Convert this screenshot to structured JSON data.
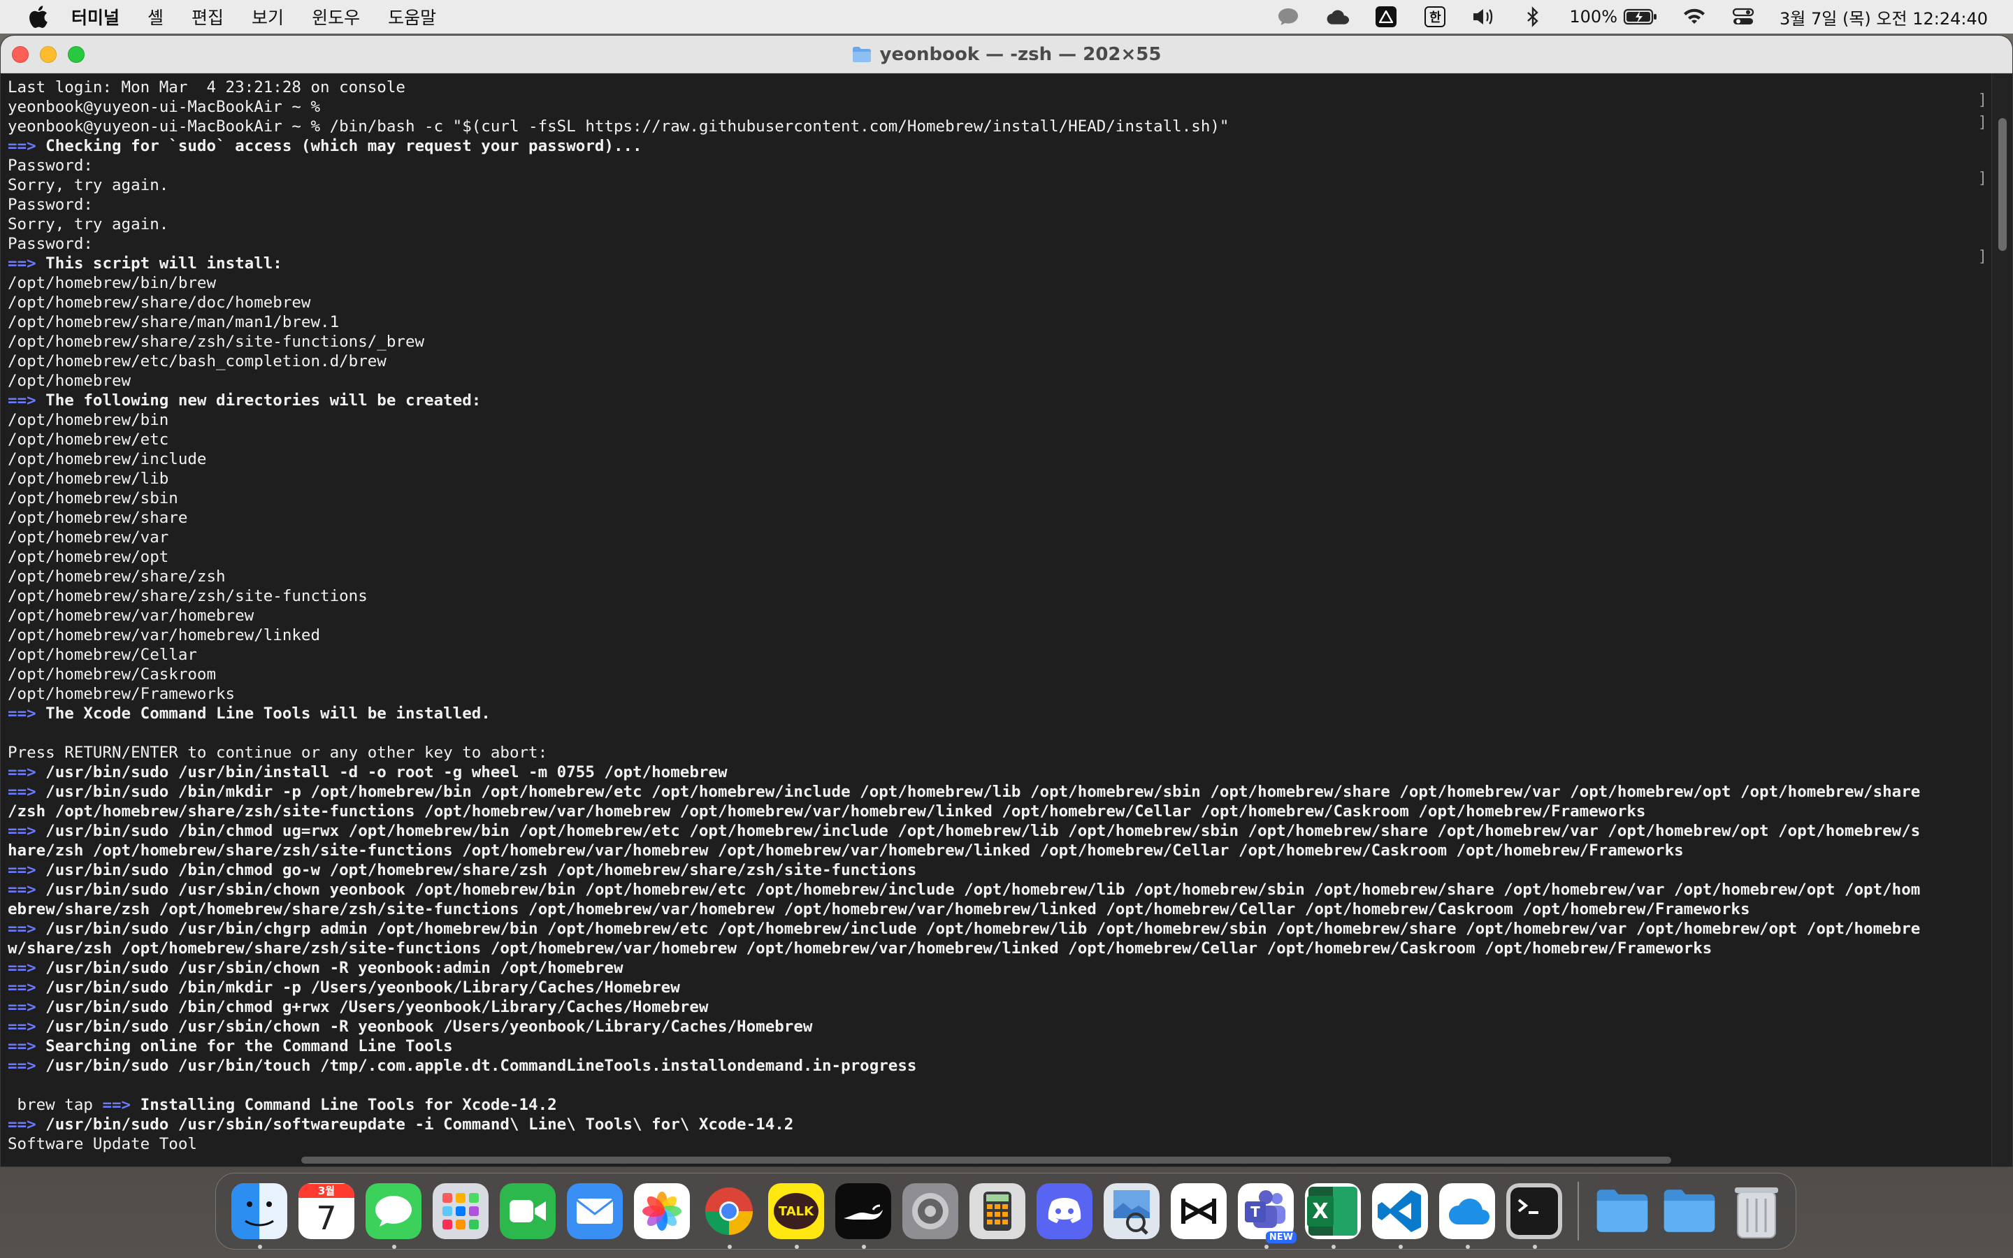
{
  "menubar": {
    "app_name": "터미널",
    "items": [
      "셸",
      "편집",
      "보기",
      "윈도우",
      "도움말"
    ],
    "battery": "100%",
    "ime": "한",
    "datetime": "3월 7일 (목) 오전 12:24:40"
  },
  "window": {
    "title": "yeonbook — -zsh — 202×55"
  },
  "terminal": {
    "lines": [
      {
        "prefix": "",
        "text": "Last login: Mon Mar  4 23:21:28 on console",
        "bold": false
      },
      {
        "prefix": "",
        "text": "yeonbook@yuyeon-ui-MacBookAir ~ %",
        "bold": false
      },
      {
        "prefix": "",
        "text": "yeonbook@yuyeon-ui-MacBookAir ~ % /bin/bash -c \"$(curl -fsSL https://raw.githubusercontent.com/Homebrew/install/HEAD/install.sh)\"",
        "bold": false
      },
      {
        "prefix": "==>",
        "text": " Checking for `sudo` access (which may request your password)...",
        "bold": true
      },
      {
        "prefix": "",
        "text": "Password:",
        "bold": false
      },
      {
        "prefix": "",
        "text": "Sorry, try again.",
        "bold": false
      },
      {
        "prefix": "",
        "text": "Password:",
        "bold": false
      },
      {
        "prefix": "",
        "text": "Sorry, try again.",
        "bold": false
      },
      {
        "prefix": "",
        "text": "Password:",
        "bold": false
      },
      {
        "prefix": "==>",
        "text": " This script will install:",
        "bold": true
      },
      {
        "prefix": "",
        "text": "/opt/homebrew/bin/brew",
        "bold": false
      },
      {
        "prefix": "",
        "text": "/opt/homebrew/share/doc/homebrew",
        "bold": false
      },
      {
        "prefix": "",
        "text": "/opt/homebrew/share/man/man1/brew.1",
        "bold": false
      },
      {
        "prefix": "",
        "text": "/opt/homebrew/share/zsh/site-functions/_brew",
        "bold": false
      },
      {
        "prefix": "",
        "text": "/opt/homebrew/etc/bash_completion.d/brew",
        "bold": false
      },
      {
        "prefix": "",
        "text": "/opt/homebrew",
        "bold": false
      },
      {
        "prefix": "==>",
        "text": " The following new directories will be created:",
        "bold": true
      },
      {
        "prefix": "",
        "text": "/opt/homebrew/bin",
        "bold": false
      },
      {
        "prefix": "",
        "text": "/opt/homebrew/etc",
        "bold": false
      },
      {
        "prefix": "",
        "text": "/opt/homebrew/include",
        "bold": false
      },
      {
        "prefix": "",
        "text": "/opt/homebrew/lib",
        "bold": false
      },
      {
        "prefix": "",
        "text": "/opt/homebrew/sbin",
        "bold": false
      },
      {
        "prefix": "",
        "text": "/opt/homebrew/share",
        "bold": false
      },
      {
        "prefix": "",
        "text": "/opt/homebrew/var",
        "bold": false
      },
      {
        "prefix": "",
        "text": "/opt/homebrew/opt",
        "bold": false
      },
      {
        "prefix": "",
        "text": "/opt/homebrew/share/zsh",
        "bold": false
      },
      {
        "prefix": "",
        "text": "/opt/homebrew/share/zsh/site-functions",
        "bold": false
      },
      {
        "prefix": "",
        "text": "/opt/homebrew/var/homebrew",
        "bold": false
      },
      {
        "prefix": "",
        "text": "/opt/homebrew/var/homebrew/linked",
        "bold": false
      },
      {
        "prefix": "",
        "text": "/opt/homebrew/Cellar",
        "bold": false
      },
      {
        "prefix": "",
        "text": "/opt/homebrew/Caskroom",
        "bold": false
      },
      {
        "prefix": "",
        "text": "/opt/homebrew/Frameworks",
        "bold": false
      },
      {
        "prefix": "==>",
        "text": " The Xcode Command Line Tools will be installed.",
        "bold": true
      },
      {
        "prefix": "",
        "text": "",
        "bold": false
      },
      {
        "prefix": "",
        "text": "Press RETURN/ENTER to continue or any other key to abort:",
        "bold": false
      },
      {
        "prefix": "==>",
        "text": " /usr/bin/sudo /usr/bin/install -d -o root -g wheel -m 0755 /opt/homebrew",
        "bold": true
      },
      {
        "prefix": "==>",
        "text": " /usr/bin/sudo /bin/mkdir -p /opt/homebrew/bin /opt/homebrew/etc /opt/homebrew/include /opt/homebrew/lib /opt/homebrew/sbin /opt/homebrew/share /opt/homebrew/var /opt/homebrew/opt /opt/homebrew/share",
        "bold": true
      },
      {
        "prefix": "",
        "text": "/zsh /opt/homebrew/share/zsh/site-functions /opt/homebrew/var/homebrew /opt/homebrew/var/homebrew/linked /opt/homebrew/Cellar /opt/homebrew/Caskroom /opt/homebrew/Frameworks",
        "bold": true
      },
      {
        "prefix": "==>",
        "text": " /usr/bin/sudo /bin/chmod ug=rwx /opt/homebrew/bin /opt/homebrew/etc /opt/homebrew/include /opt/homebrew/lib /opt/homebrew/sbin /opt/homebrew/share /opt/homebrew/var /opt/homebrew/opt /opt/homebrew/s",
        "bold": true
      },
      {
        "prefix": "",
        "text": "hare/zsh /opt/homebrew/share/zsh/site-functions /opt/homebrew/var/homebrew /opt/homebrew/var/homebrew/linked /opt/homebrew/Cellar /opt/homebrew/Caskroom /opt/homebrew/Frameworks",
        "bold": true
      },
      {
        "prefix": "==>",
        "text": " /usr/bin/sudo /bin/chmod go-w /opt/homebrew/share/zsh /opt/homebrew/share/zsh/site-functions",
        "bold": true
      },
      {
        "prefix": "==>",
        "text": " /usr/bin/sudo /usr/sbin/chown yeonbook /opt/homebrew/bin /opt/homebrew/etc /opt/homebrew/include /opt/homebrew/lib /opt/homebrew/sbin /opt/homebrew/share /opt/homebrew/var /opt/homebrew/opt /opt/hom",
        "bold": true
      },
      {
        "prefix": "",
        "text": "ebrew/share/zsh /opt/homebrew/share/zsh/site-functions /opt/homebrew/var/homebrew /opt/homebrew/var/homebrew/linked /opt/homebrew/Cellar /opt/homebrew/Caskroom /opt/homebrew/Frameworks",
        "bold": true
      },
      {
        "prefix": "==>",
        "text": " /usr/bin/sudo /usr/bin/chgrp admin /opt/homebrew/bin /opt/homebrew/etc /opt/homebrew/include /opt/homebrew/lib /opt/homebrew/sbin /opt/homebrew/share /opt/homebrew/var /opt/homebrew/opt /opt/homebre",
        "bold": true
      },
      {
        "prefix": "",
        "text": "w/share/zsh /opt/homebrew/share/zsh/site-functions /opt/homebrew/var/homebrew /opt/homebrew/var/homebrew/linked /opt/homebrew/Cellar /opt/homebrew/Caskroom /opt/homebrew/Frameworks",
        "bold": true
      },
      {
        "prefix": "==>",
        "text": " /usr/bin/sudo /usr/sbin/chown -R yeonbook:admin /opt/homebrew",
        "bold": true
      },
      {
        "prefix": "==>",
        "text": " /usr/bin/sudo /bin/mkdir -p /Users/yeonbook/Library/Caches/Homebrew",
        "bold": true
      },
      {
        "prefix": "==>",
        "text": " /usr/bin/sudo /bin/chmod g+rwx /Users/yeonbook/Library/Caches/Homebrew",
        "bold": true
      },
      {
        "prefix": "==>",
        "text": " /usr/bin/sudo /usr/sbin/chown -R yeonbook /Users/yeonbook/Library/Caches/Homebrew",
        "bold": true
      },
      {
        "prefix": "==>",
        "text": " Searching online for the Command Line Tools",
        "bold": true
      },
      {
        "prefix": "==>",
        "text": " /usr/bin/sudo /usr/bin/touch /tmp/.com.apple.dt.CommandLineTools.installondemand.in-progress",
        "bold": true
      },
      {
        "prefix": "",
        "text": "",
        "bold": false
      },
      {
        "prefix": " brew tap ==>",
        "text": " Installing Command Line Tools for Xcode-14.2",
        "bold": true
      },
      {
        "prefix": "==>",
        "text": " /usr/bin/sudo /usr/sbin/softwareupdate -i Command\\ Line\\ Tools\\ for\\ Xcode-14.2",
        "bold": true
      },
      {
        "prefix": "",
        "text": "Software Update Tool",
        "bold": false
      }
    ]
  },
  "dock": {
    "apps": [
      {
        "name": "Finder",
        "icon": "finder-icon",
        "color": "#3b8ef0",
        "running": true
      },
      {
        "name": "Calendar",
        "icon": "calendar-icon",
        "color": "#ffffff",
        "month": "3월",
        "day": "7",
        "running": false
      },
      {
        "name": "Messages",
        "icon": "messages-icon",
        "color": "#34c759",
        "running": true
      },
      {
        "name": "Launchpad",
        "icon": "launchpad-icon",
        "color": "#d0d0d8",
        "running": false
      },
      {
        "name": "FaceTime",
        "icon": "facetime-icon",
        "color": "#2db84d",
        "running": false
      },
      {
        "name": "Mail",
        "icon": "mail-icon",
        "color": "#3a8ff5",
        "running": false
      },
      {
        "name": "Photos",
        "icon": "photos-icon",
        "color": "#ffffff",
        "running": false
      },
      {
        "name": "Chrome",
        "icon": "chrome-icon",
        "color": "#ffffff",
        "running": true
      },
      {
        "name": "KakaoTalk",
        "icon": "kakaotalk-icon",
        "color": "#ffe812",
        "label": "TALK",
        "running": true
      },
      {
        "name": "Genie",
        "icon": "genie-icon",
        "color": "#111111",
        "running": true
      },
      {
        "name": "System Settings",
        "icon": "settings-icon",
        "color": "#8e8e93",
        "running": false
      },
      {
        "name": "Calculator",
        "icon": "calculator-icon",
        "color": "#dcdcdc",
        "running": false
      },
      {
        "name": "Discord",
        "icon": "discord-icon",
        "color": "#5865f2",
        "running": false
      },
      {
        "name": "Preview",
        "icon": "preview-icon",
        "color": "#dfe6ee",
        "running": false
      },
      {
        "name": "CapCut",
        "icon": "capcut-icon",
        "color": "#ffffff",
        "running": false
      },
      {
        "name": "Teams",
        "icon": "teams-icon",
        "color": "#5b5fc7",
        "badge": "NEW",
        "running": true
      },
      {
        "name": "Excel",
        "icon": "excel-icon",
        "color": "#1f7a45",
        "label": "X",
        "running": true
      },
      {
        "name": "VS Code",
        "icon": "vscode-icon",
        "color": "#ffffff",
        "running": true
      },
      {
        "name": "OneDrive",
        "icon": "onedrive-icon",
        "color": "#ffffff",
        "running": true
      },
      {
        "name": "Terminal",
        "icon": "terminal-icon",
        "color": "#1a1a1a",
        "running": true
      }
    ],
    "stacks": [
      {
        "name": "Downloads",
        "icon": "folder-icon"
      },
      {
        "name": "Folder",
        "icon": "folder-icon"
      },
      {
        "name": "Trash",
        "icon": "trash-icon"
      }
    ]
  }
}
